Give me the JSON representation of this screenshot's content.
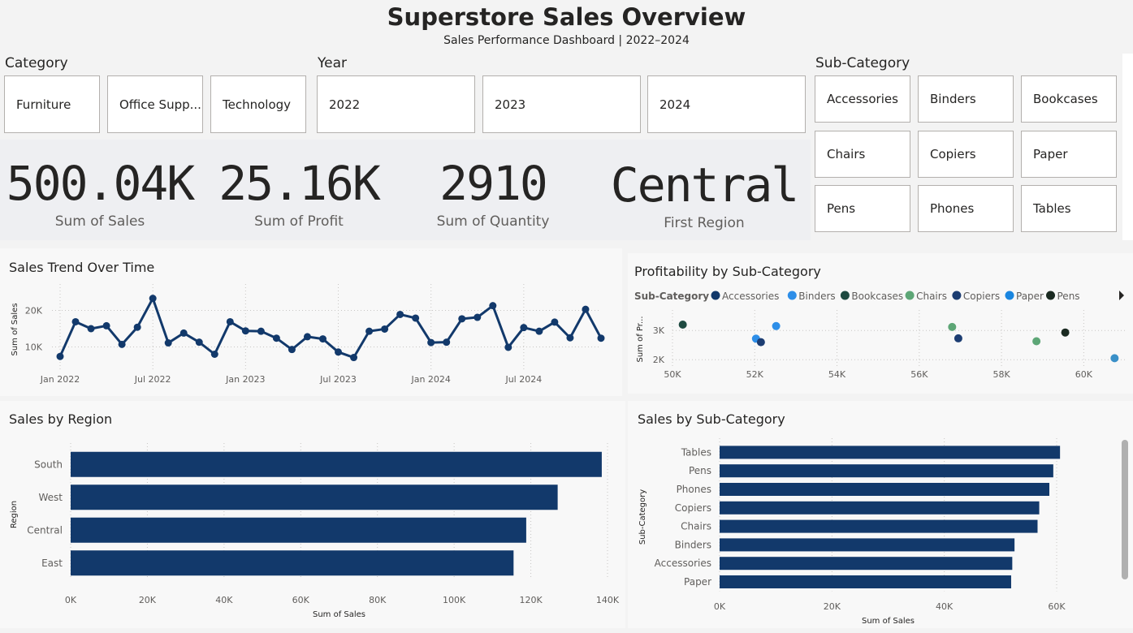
{
  "header": {
    "title": "Superstore Sales Overview",
    "subtitle": "Sales Performance Dashboard | 2022–2024"
  },
  "slicers": {
    "category": {
      "label": "Category",
      "options": [
        "Furniture",
        "Office Supp...",
        "Technology"
      ]
    },
    "year": {
      "label": "Year",
      "options": [
        "2022",
        "2023",
        "2024"
      ]
    },
    "subcategory": {
      "label": "Sub-Category",
      "options": [
        "Accessories",
        "Binders",
        "Bookcases",
        "Chairs",
        "Copiers",
        "Paper",
        "Pens",
        "Phones",
        "Tables"
      ]
    }
  },
  "kpis": [
    {
      "value": "500.04K",
      "label": "Sum of Sales"
    },
    {
      "value": "25.16K",
      "label": "Sum of Profit"
    },
    {
      "value": "2910",
      "label": "Sum of Quantity"
    },
    {
      "value": "Central",
      "label": "First Region"
    }
  ],
  "colors": {
    "bar": "#12396b",
    "line": "#12396b"
  },
  "chart_data": [
    {
      "type": "line",
      "title": "Sales Trend Over Time",
      "xlabel": "",
      "ylabel": "Sum of Sales",
      "x_ticks": [
        "Jan 2022",
        "Jul 2022",
        "Jan 2023",
        "Jul 2023",
        "Jan 2024",
        "Jul 2024"
      ],
      "y_ticks": [
        "10K",
        "20K"
      ],
      "ylim": [
        5000,
        25000
      ],
      "x": [
        "2022-01",
        "2022-02",
        "2022-03",
        "2022-04",
        "2022-05",
        "2022-06",
        "2022-07",
        "2022-08",
        "2022-09",
        "2022-10",
        "2022-11",
        "2022-12",
        "2023-01",
        "2023-02",
        "2023-03",
        "2023-04",
        "2023-05",
        "2023-06",
        "2023-07",
        "2023-08",
        "2023-09",
        "2023-10",
        "2023-11",
        "2023-12",
        "2024-01",
        "2024-02",
        "2024-03",
        "2024-04",
        "2024-05",
        "2024-06",
        "2024-07",
        "2024-08",
        "2024-09",
        "2024-10",
        "2024-11",
        "2024-12"
      ],
      "values": [
        7400,
        16900,
        15000,
        15800,
        10700,
        15400,
        23300,
        11100,
        13800,
        11300,
        8000,
        16900,
        14400,
        14300,
        12400,
        9300,
        12800,
        12200,
        8600,
        7100,
        14300,
        14900,
        18900,
        17900,
        11200,
        11300,
        17700,
        18100,
        21300,
        9900,
        15300,
        14300,
        16800,
        12500,
        20300,
        12400
      ],
      "grid": true
    },
    {
      "type": "scatter",
      "title": "Profitability by Sub-Category",
      "xlabel": "",
      "ylabel": "Sum of Pr...",
      "legend_title": "Sub-Category",
      "legend": [
        {
          "name": "Accessories",
          "color": "#12396b"
        },
        {
          "name": "Binders",
          "color": "#2d8ee8"
        },
        {
          "name": "Bookcases",
          "color": "#1e4a41"
        },
        {
          "name": "Chairs",
          "color": "#5da676"
        },
        {
          "name": "Copiers",
          "color": "#1c3d72"
        },
        {
          "name": "Paper",
          "color": "#1a86e0"
        },
        {
          "name": "Pens",
          "color": "#1a2a21"
        }
      ],
      "x_ticks": [
        "50K",
        "52K",
        "54K",
        "56K",
        "58K",
        "60K"
      ],
      "y_ticks": [
        "2K",
        "3K"
      ],
      "xlim": [
        50000,
        61000
      ],
      "ylim": [
        1700,
        3700
      ],
      "points": [
        {
          "x": 50250,
          "y": 3200,
          "color": "#1e4a41"
        },
        {
          "x": 52030,
          "y": 2720,
          "color": "#2d8ee8"
        },
        {
          "x": 52150,
          "y": 2600,
          "color": "#1c3d72"
        },
        {
          "x": 52520,
          "y": 3150,
          "color": "#2d8ee8"
        },
        {
          "x": 56800,
          "y": 3120,
          "color": "#5da676"
        },
        {
          "x": 56950,
          "y": 2730,
          "color": "#1c3d72"
        },
        {
          "x": 58850,
          "y": 2630,
          "color": "#5da676"
        },
        {
          "x": 59550,
          "y": 2930,
          "color": "#1a2a21"
        },
        {
          "x": 60750,
          "y": 2050,
          "color": "#3a90c8"
        }
      ],
      "legend_placement": "top",
      "grid": true
    },
    {
      "type": "bar",
      "orientation": "horizontal",
      "title": "Sales by Region",
      "xlabel": "Sum of Sales",
      "ylabel": "Region",
      "categories": [
        "South",
        "West",
        "Central",
        "East"
      ],
      "values": [
        138500,
        127000,
        118800,
        115500
      ],
      "x_ticks": [
        "0K",
        "20K",
        "40K",
        "60K",
        "80K",
        "100K",
        "120K",
        "140K"
      ],
      "xlim": [
        0,
        140000
      ],
      "grid": true
    },
    {
      "type": "bar",
      "orientation": "horizontal",
      "title": "Sales by Sub-Category",
      "xlabel": "Sum of Sales",
      "ylabel": "Sub-Category",
      "categories": [
        "Tables",
        "Pens",
        "Phones",
        "Copiers",
        "Chairs",
        "Binders",
        "Accessories",
        "Paper"
      ],
      "values": [
        60600,
        59400,
        58700,
        56900,
        56600,
        52500,
        52100,
        51900
      ],
      "x_ticks": [
        "0K",
        "20K",
        "40K",
        "60K"
      ],
      "xlim": [
        0,
        60000
      ],
      "grid": true
    }
  ]
}
